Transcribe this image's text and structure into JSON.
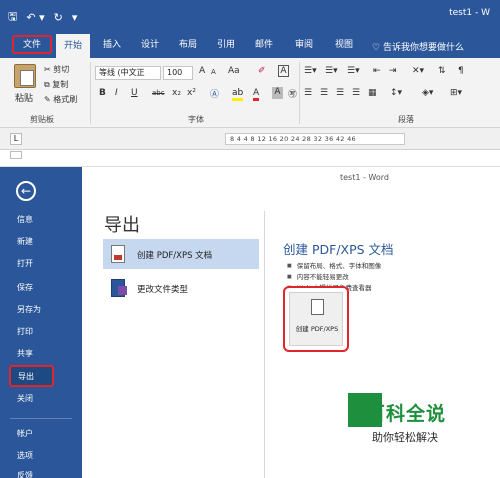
{
  "window": {
    "title": "test1 - W"
  },
  "qat": {
    "save": "🖫",
    "undo": "↶ ▾",
    "redo": "↻",
    "more": "▾"
  },
  "tabs": {
    "file": "文件",
    "items": [
      "开始",
      "插入",
      "设计",
      "布局",
      "引用",
      "邮件",
      "审阅",
      "视图"
    ],
    "active": "开始",
    "tell_me": "告诉我你想要做什么"
  },
  "ribbon": {
    "clipboard": {
      "paste": "粘贴",
      "cut": "剪切",
      "copy": "复制",
      "format_painter": "格式刷",
      "label": "剪贴板"
    },
    "font": {
      "name": "等线 (中文正",
      "size": "100",
      "grow": "A",
      "shrink": "A",
      "case": "Aa",
      "label": "字体",
      "bold": "B",
      "italic": "I",
      "underline": "U",
      "strike": "abc",
      "sub": "x₂",
      "sup": "x²"
    },
    "paragraph": {
      "label": "段落"
    }
  },
  "ruler": {
    "tab_marker": "L",
    "ticks": "8  4    4  8 12 16 20 24 28 32 36  42 46"
  },
  "backstage": {
    "window_title": "test1 - Word",
    "back": "←",
    "nav": [
      "信息",
      "新建",
      "打开",
      "保存",
      "另存为",
      "打印",
      "共享"
    ],
    "export": "导出",
    "close": "关闭",
    "nav_bottom": [
      "帐户",
      "选项",
      "反馈"
    ],
    "heading": "导出",
    "options": [
      {
        "label": "创建 PDF/XPS 文档",
        "selected": true,
        "icon": "pdf-document-icon"
      },
      {
        "label": "更改文件类型",
        "selected": false,
        "icon": "change-file-type-icon"
      }
    ],
    "detail": {
      "title": "创建 PDF/XPS 文档",
      "bullets": [
        "保留布局、格式、字体和图像",
        "内容不能轻易更改",
        "Web 上提供了免费查看器"
      ],
      "create_button": "创建 PDF/XPS"
    }
  },
  "watermark": {
    "title": "百科全说",
    "subtitle": "助你轻松解决"
  },
  "colors": {
    "word_blue": "#2b579a",
    "highlight_red": "#e0262d",
    "selected_option": "#c5d8ef",
    "watermark_green": "#1e8f3c"
  }
}
